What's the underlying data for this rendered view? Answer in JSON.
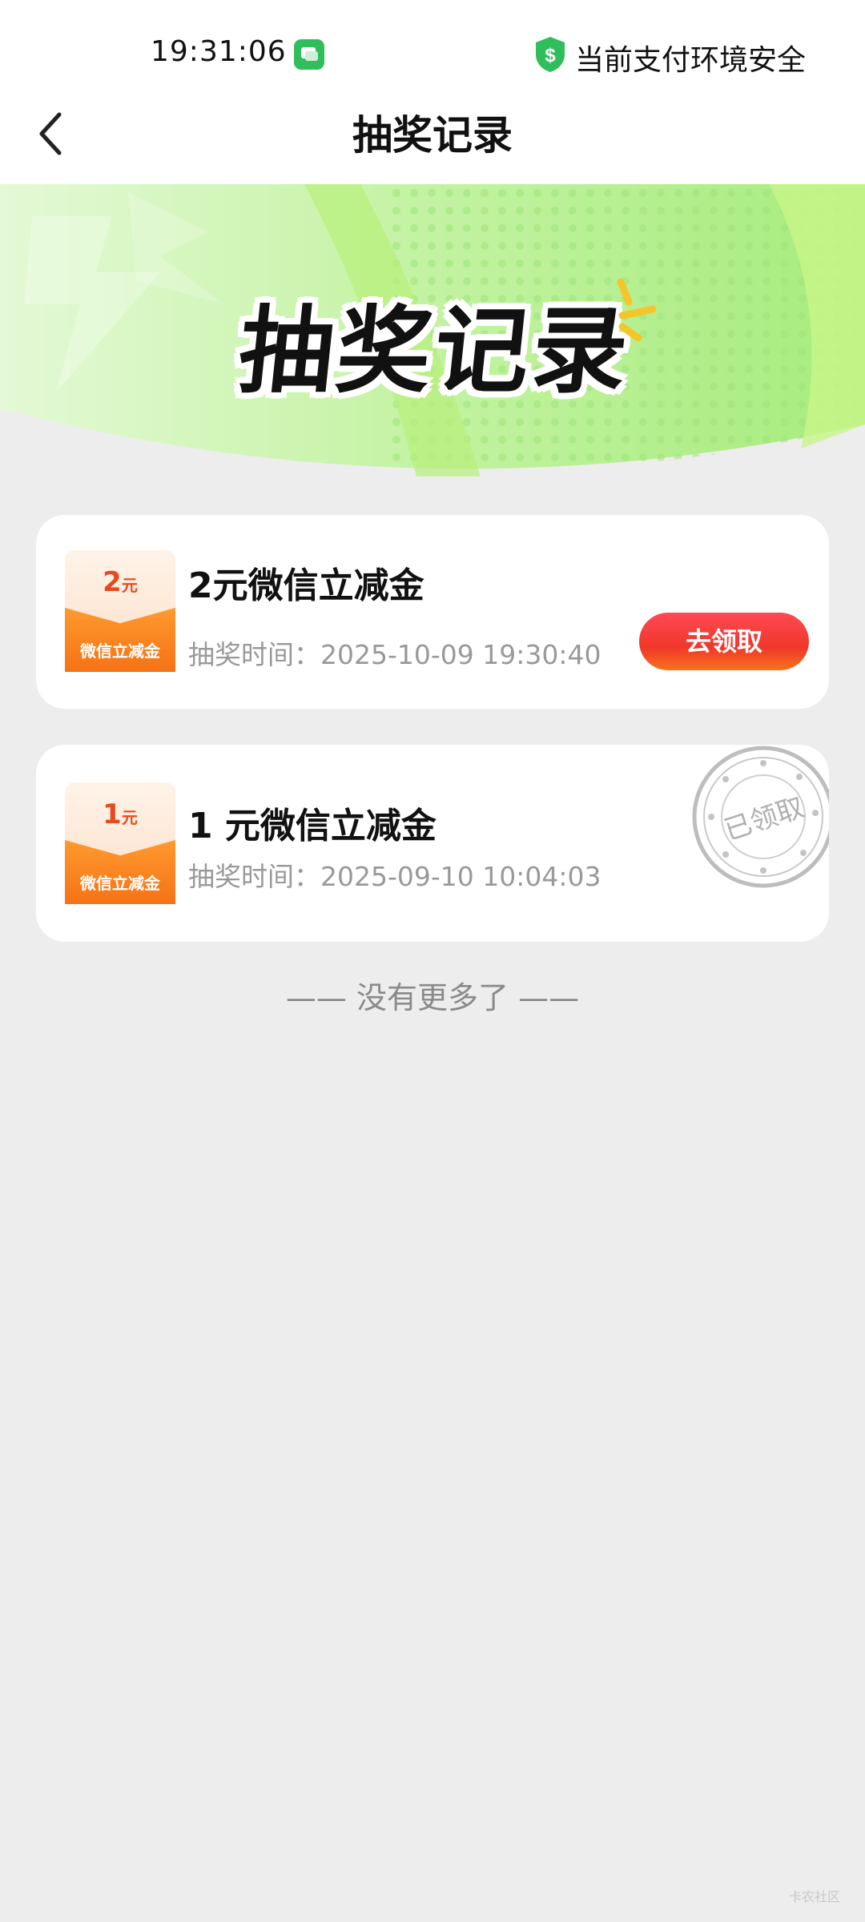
{
  "status_bar": {
    "time": "19:31:06",
    "notification_icon": "message-icon",
    "safety_icon": "shield-dollar-icon",
    "safety_text": "当前支付环境安全"
  },
  "nav": {
    "back_icon": "chevron-left-icon",
    "title": "抽奖记录"
  },
  "banner": {
    "title": "抽奖记录",
    "colors": {
      "green_light": "#c9f5a8",
      "green": "#8ee86a",
      "yellow": "#f5c52a"
    }
  },
  "records": [
    {
      "coupon_amount": "2",
      "coupon_unit": "元",
      "coupon_label": "微信立减金",
      "prize_name": "2元微信立减金",
      "draw_time": "抽奖时间：2025-10-09 19:30:40",
      "action_label": "去领取",
      "status": "unclaimed"
    },
    {
      "coupon_amount": "1",
      "coupon_unit": "元",
      "coupon_label": "微信立减金",
      "prize_name": "1 元微信立减金",
      "draw_time": "抽奖时间：2025-09-10 10:04:03",
      "stamp_text": "已领取",
      "status": "claimed"
    }
  ],
  "footer": {
    "no_more": "—— 没有更多了 ——"
  },
  "watermark": "卡农社区",
  "colors": {
    "accent_red": "#f0372a",
    "coupon_orange": "#f57215",
    "page_bg": "#ededed",
    "safety_green": "#2fbe5b"
  }
}
